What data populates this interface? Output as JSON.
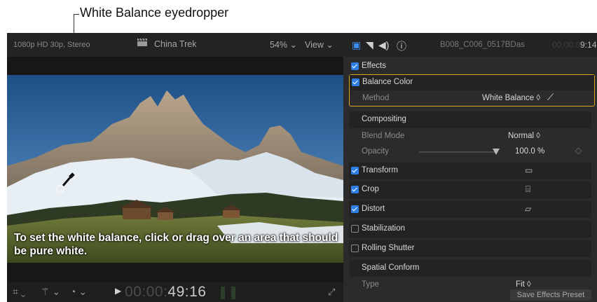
{
  "callout": {
    "text": "White Balance eyedropper"
  },
  "viewer": {
    "format": "1080p HD 30p, Stereo",
    "project_title": "China Trek",
    "zoom": "54% ⌄",
    "view_menu": "View ⌄",
    "subtitle": "To set the white balance, click or drag over an area that should be pure white.",
    "timecode_dim": "00:00:",
    "timecode_bright": "49:16",
    "play_icon": "▶"
  },
  "inspector": {
    "clip_name": "B008_C006_0517BDas",
    "timecode_dim": "00:00:0",
    "timecode_bright": "9:14",
    "rows": {
      "effects": "Effects",
      "balance_color": "Balance Color",
      "method_label": "Method",
      "method_value": "White Balance ◊",
      "compositing": "Compositing",
      "blend_mode_label": "Blend Mode",
      "blend_mode_value": "Normal ◊",
      "opacity_label": "Opacity",
      "opacity_value": "100.0 %",
      "transform": "Transform",
      "crop": "Crop",
      "distort": "Distort",
      "stabilization": "Stabilization",
      "rolling_shutter": "Rolling Shutter",
      "spatial_conform": "Spatial Conform",
      "type_label": "Type",
      "type_value": "Fit ◊"
    },
    "save_preset": "Save Effects Preset"
  },
  "opacity_level": 1.0,
  "colors": {
    "accent_check": "#2f7ee6",
    "highlight_border": "#d8a622",
    "panel_bg": "#2b2b2b"
  }
}
